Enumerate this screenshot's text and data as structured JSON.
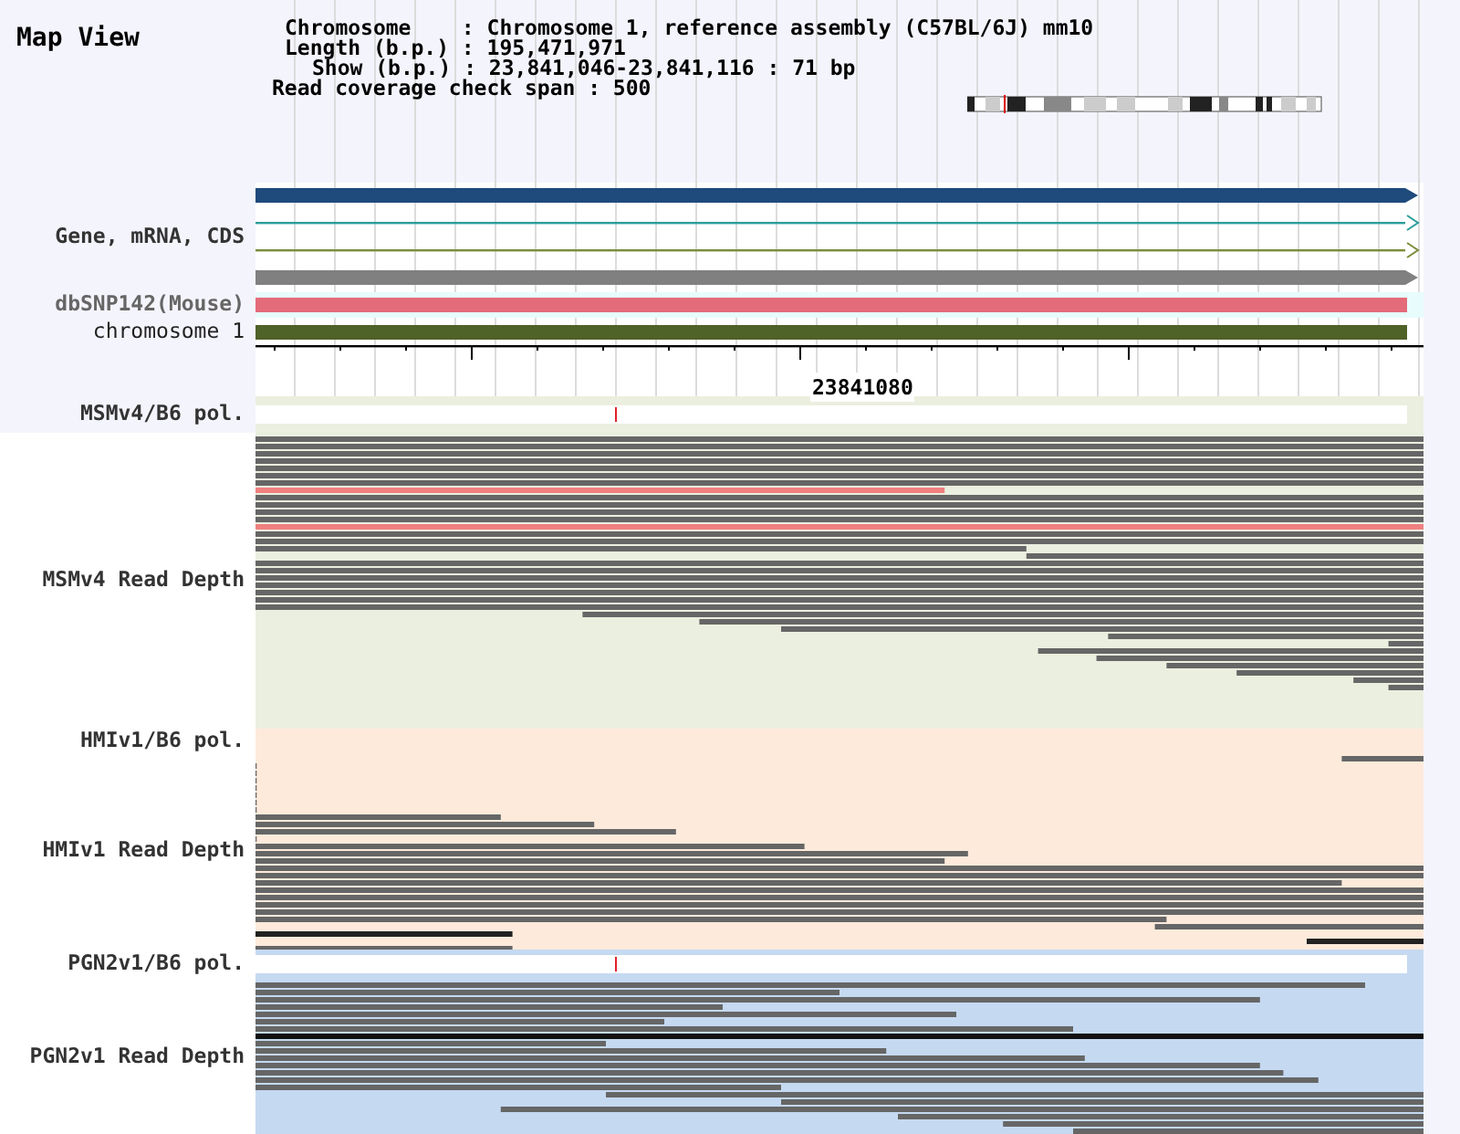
{
  "header": {
    "title": "Map View",
    "info_lines": [
      "Chromosome    : Chromosome 1, reference assembly (C57BL/6J) mm10",
      "Length (b.p.) : 195,471,971",
      "Show (b.p.) : 23,841,046-23,841,116 : 71 bp",
      "Read coverage check span : 500"
    ]
  },
  "tracks": [
    {
      "label": "Gene, mRNA, CDS"
    },
    {
      "label": "dbSNP142(Mouse)",
      "color": "#e46c7a"
    },
    {
      "label": "chromosome 1",
      "color": "#4f6228"
    }
  ],
  "ruler": {
    "label": "23841080"
  },
  "samples": [
    {
      "pol_label": "MSMv4/B6 pol.",
      "depth_label": "MSMv4 Read Depth",
      "color": "#ebefdf",
      "pol_bar": true
    },
    {
      "pol_label": "HMIv1/B6 pol.",
      "depth_label": "HMIv1 Read Depth",
      "color": "#fdeadb",
      "pol_bar": false
    },
    {
      "pol_label": "PGN2v1/B6 pol.",
      "depth_label": "PGN2v1 Read Depth",
      "color": "#c5d9f1",
      "pol_bar": true
    }
  ]
}
